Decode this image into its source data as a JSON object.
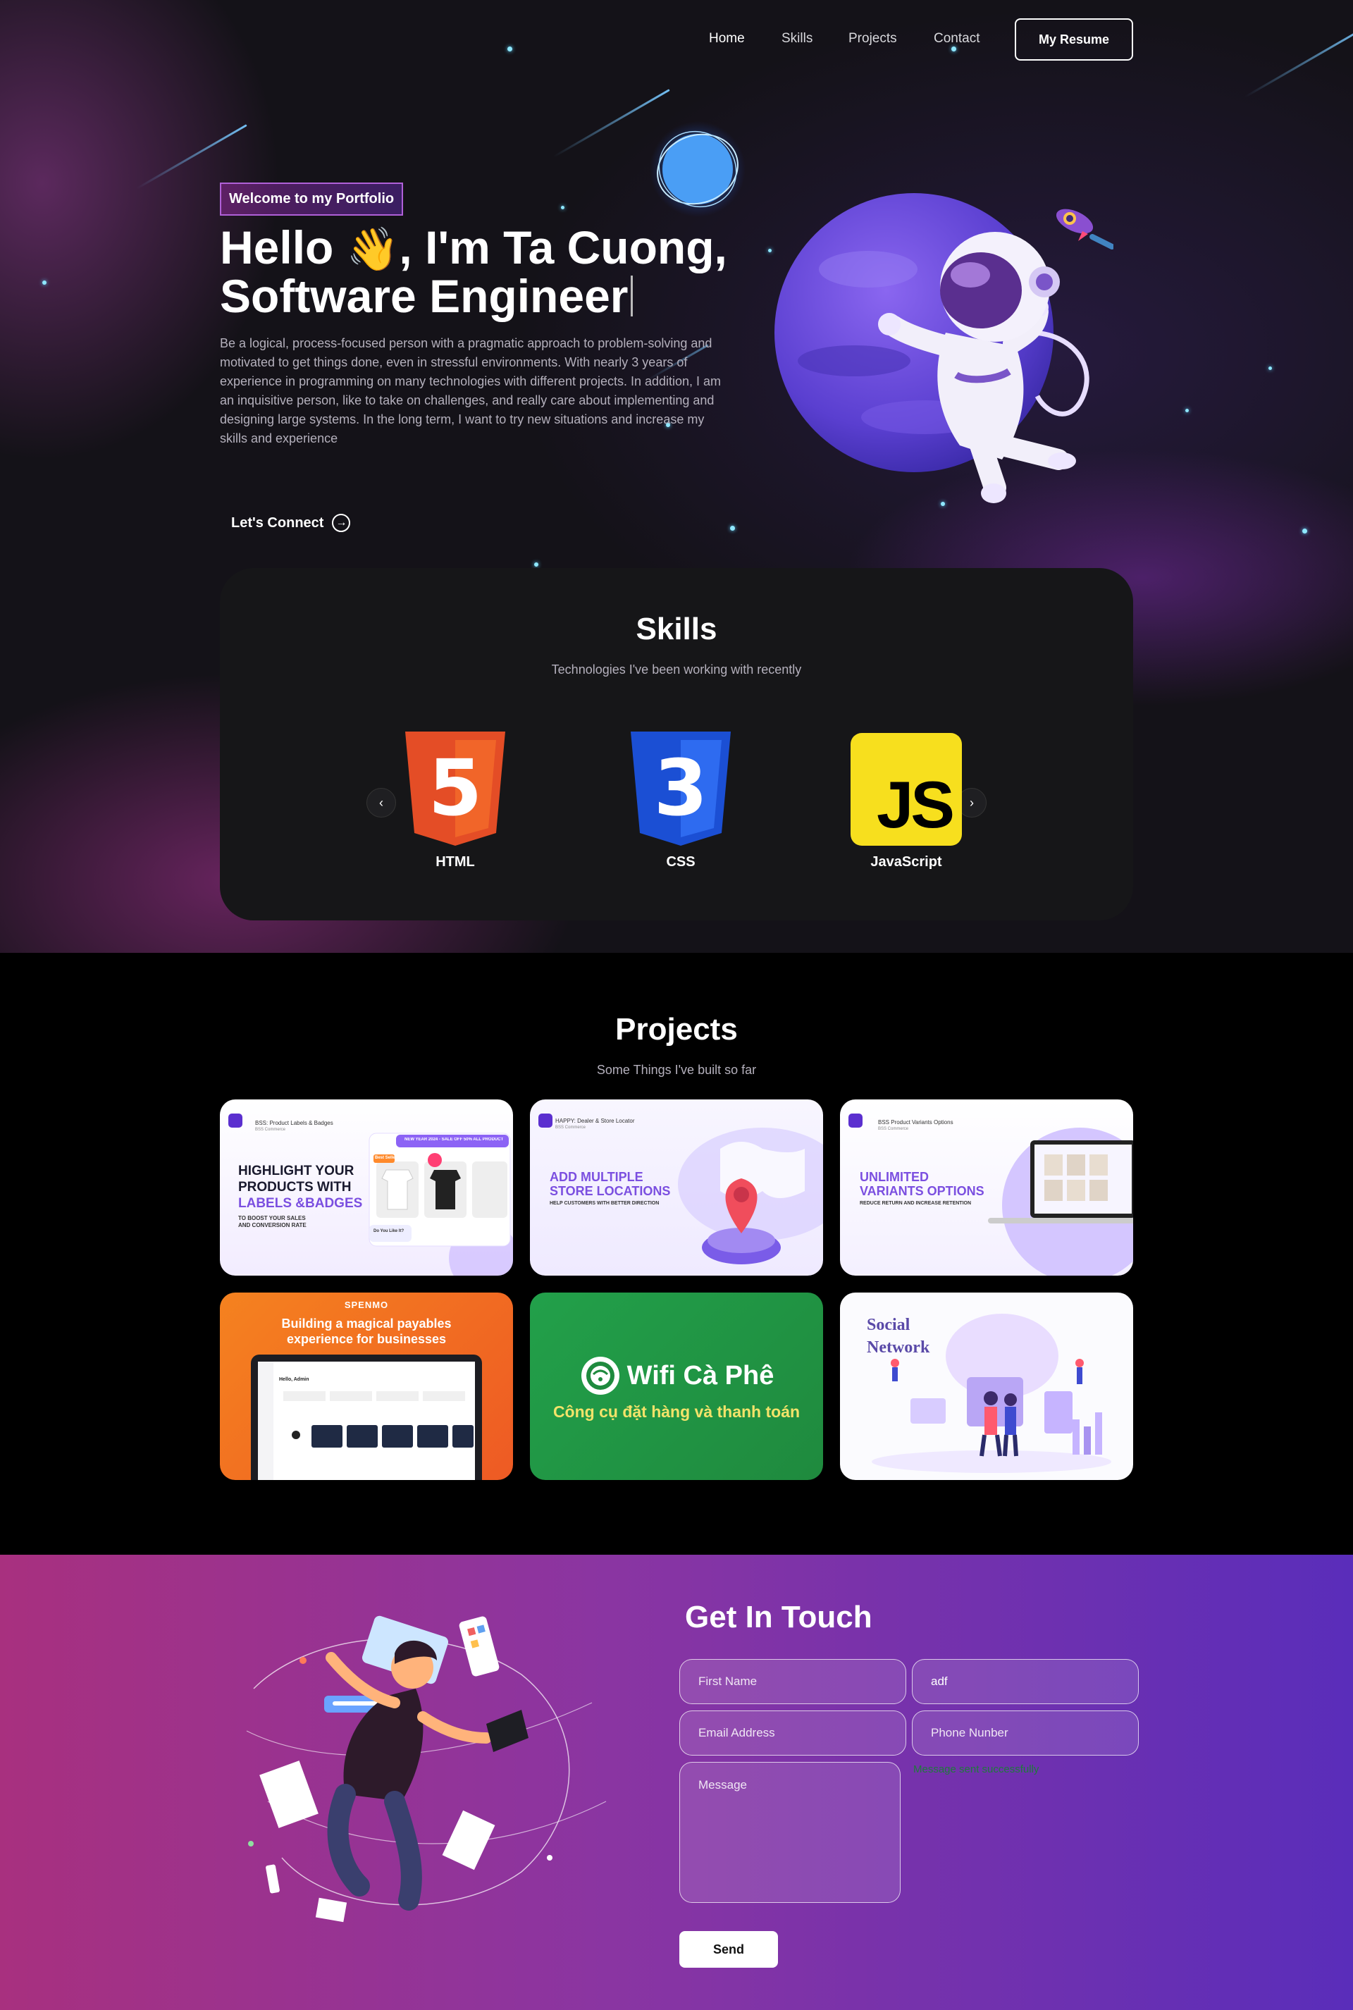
{
  "nav": {
    "links": [
      "Home",
      "Skills",
      "Projects",
      "Contact"
    ],
    "resume_label": "My Resume"
  },
  "hero": {
    "badge": "Welcome to my Portfolio",
    "headline_line1_pre": "Hello ",
    "headline_line1_emoji": "👋",
    "headline_line1_post": ", I'm Ta Cuong,",
    "headline_line2": "Software Engineer",
    "intro": "Be a logical, process-focused person with a pragmatic approach to problem-solving and motivated to get things done, even in stressful environments. With nearly 3 years of experience in programming on many technologies with different projects. In addition, I am an inquisitive person, like to take on challenges, and really care about implementing and designing large systems. In the long term, I want to try new situations and increase my skills and experience",
    "connect_label": "Let's Connect",
    "connect_icon": "arrow-circle-right-icon"
  },
  "skills": {
    "title": "Skills",
    "subtitle": "Technologies I've been working with recently",
    "items": [
      {
        "name": "HTML",
        "badge": "5"
      },
      {
        "name": "CSS",
        "badge": "3"
      },
      {
        "name": "JavaScript",
        "badge": "JS"
      }
    ]
  },
  "projects": {
    "title": "Projects",
    "subtitle": "Some Things I've built so far",
    "cards": [
      {
        "app": "BSS: Product Labels & Badges",
        "vendor": "BSS Commerce",
        "h1": "HIGHLIGHT YOUR",
        "h2": "PRODUCTS WITH",
        "h3": "LABELS &BADGES",
        "s1": "TO BOOST YOUR SALES",
        "s2": "AND CONVERSION RATE",
        "promo": "NEW YEAR 2024 - SALE OFF 50% ALL PRODUCT",
        "tag1": "Best Seller",
        "tag2": "Do You Like It?"
      },
      {
        "app": "HAPPY: Dealer & Store Locator",
        "vendor": "BSS Commerce",
        "h1": "ADD MULTIPLE",
        "h2": "STORE LOCATIONS",
        "sub": "HELP CUSTOMERS WITH BETTER DIRECTION"
      },
      {
        "app": "BSS Product Variants Options",
        "vendor": "BSS Commerce",
        "h1": "UNLIMITED",
        "h2": "VARIANTS OPTIONS",
        "sub": "REDUCE RETURN AND INCREASE RETENTION"
      },
      {
        "brand": "SPENMO",
        "h1": "Building a magical payables",
        "h2": "experience for businesses",
        "greet": "Hello, Admin"
      },
      {
        "name": "Wifi Cà Phê",
        "sub": "Công cụ đặt hàng và thanh toán"
      },
      {
        "h1": "Social",
        "h2": "Network"
      }
    ]
  },
  "contact": {
    "title": "Get In Touch",
    "first_name_placeholder": "First Name",
    "last_name_value": "adf",
    "email_placeholder": "Email Address",
    "phone_placeholder": "Phone Nunber",
    "message_placeholder": "Message",
    "error_text": "Message sent successfully",
    "send_label": "Send"
  },
  "colors": {
    "accent_purple": "#7b4fe0",
    "contact_start": "#a8307f",
    "contact_end": "#5a2dba",
    "html_orange": "#e44d26",
    "css_blue": "#2462e8",
    "js_yellow": "#f7df1e",
    "wifi_green": "#239446"
  }
}
